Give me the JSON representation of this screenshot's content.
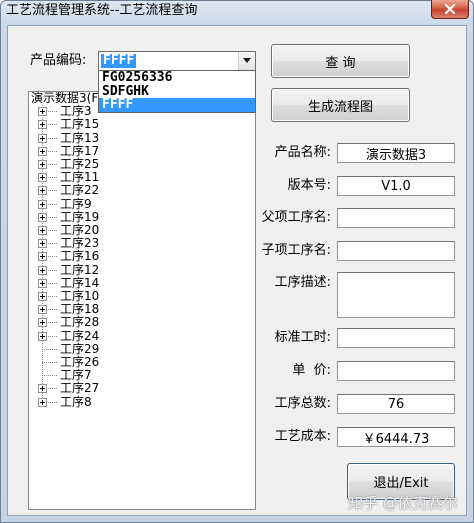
{
  "window": {
    "title": "工艺流程管理系统--工艺流程查询",
    "close_icon": "close-icon"
  },
  "product_code": {
    "label": "产品编码:",
    "value": "FFFF",
    "options": [
      "FG0256336",
      "SDFGHK",
      "FFFF"
    ],
    "selected_index": 2,
    "arrow_icon": "chevron-down-icon"
  },
  "tree": {
    "root": "演示数据3(F",
    "expand_icon": "plus-box-icon",
    "items": [
      {
        "label": "工序3",
        "expandable": true
      },
      {
        "label": "工序15",
        "expandable": true
      },
      {
        "label": "工序13",
        "expandable": true
      },
      {
        "label": "工序17",
        "expandable": true
      },
      {
        "label": "工序25",
        "expandable": true
      },
      {
        "label": "工序11",
        "expandable": true
      },
      {
        "label": "工序22",
        "expandable": true
      },
      {
        "label": "工序9",
        "expandable": true
      },
      {
        "label": "工序19",
        "expandable": true
      },
      {
        "label": "工序20",
        "expandable": true
      },
      {
        "label": "工序23",
        "expandable": true
      },
      {
        "label": "工序16",
        "expandable": true
      },
      {
        "label": "工序12",
        "expandable": true
      },
      {
        "label": "工序14",
        "expandable": true
      },
      {
        "label": "工序10",
        "expandable": true
      },
      {
        "label": "工序18",
        "expandable": true
      },
      {
        "label": "工序28",
        "expandable": true
      },
      {
        "label": "工序24",
        "expandable": true
      },
      {
        "label": "工序29",
        "expandable": false
      },
      {
        "label": "工序26",
        "expandable": false
      },
      {
        "label": "工序7",
        "expandable": false
      },
      {
        "label": "工序27",
        "expandable": true
      },
      {
        "label": "工序8",
        "expandable": true
      }
    ]
  },
  "buttons": {
    "query": "查 询",
    "generate_flowchart": "生成流程图",
    "exit": "退出/Exit"
  },
  "fields": {
    "product_name": {
      "label": "产品名称:",
      "value": "演示数据3"
    },
    "version": {
      "label": "版本号:",
      "value": "V1.0"
    },
    "parent_process": {
      "label": "父项工序名:",
      "value": ""
    },
    "child_process": {
      "label": "子项工序名:",
      "value": ""
    },
    "process_desc": {
      "label": "工序描述:",
      "value": ""
    },
    "standard_hours": {
      "label": "标准工时:",
      "value": ""
    },
    "unit_price": {
      "label": "单  价:",
      "value": ""
    },
    "process_count": {
      "label": "工序总数:",
      "value": "76"
    },
    "process_cost": {
      "label": "工艺成本:",
      "value": "￥6444.73"
    }
  },
  "watermark": "知乎 @依克赛尔",
  "colors": {
    "selection": "#3399ff",
    "window_body": "#f0f0f0",
    "close_button": "#c84031"
  }
}
